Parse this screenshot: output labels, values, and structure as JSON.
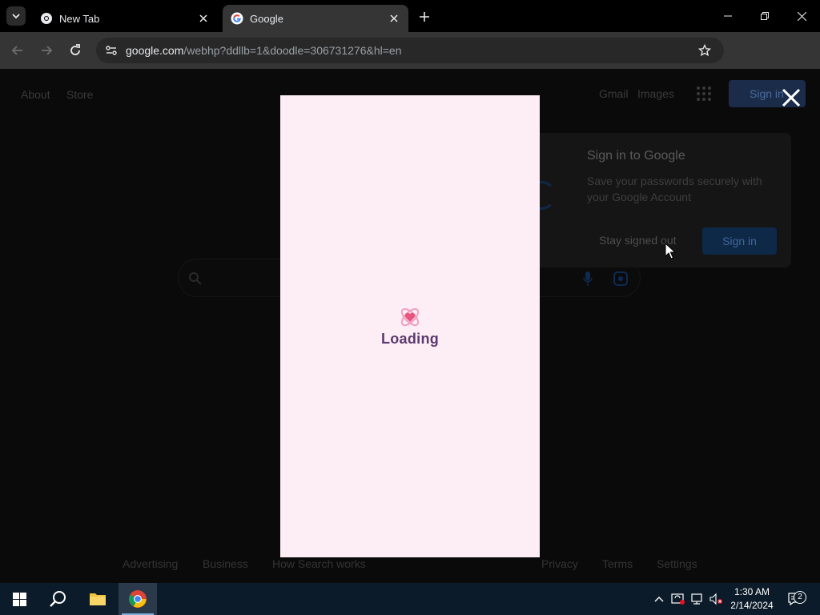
{
  "browser": {
    "tabs": [
      {
        "title": "New Tab",
        "active": false
      },
      {
        "title": "Google",
        "active": true
      }
    ],
    "url": {
      "host": "google.com",
      "path": "/webhp?ddllb=1&doodle=306731276&hl=en"
    }
  },
  "page": {
    "header_left": [
      "About",
      "Store"
    ],
    "header_right": [
      "Gmail",
      "Images"
    ],
    "signin_button": "Sign in",
    "signin_popup": {
      "title": "Sign in to Google",
      "description": "Save your passwords securely with your Google Account",
      "dismiss": "Stay signed out",
      "confirm": "Sign in"
    },
    "footer_left": [
      "Advertising",
      "Business",
      "How Search works"
    ],
    "footer_right": [
      "Privacy",
      "Terms",
      "Settings"
    ]
  },
  "modal": {
    "loading_text": "Loading",
    "background_color": "#fdeef5",
    "text_color": "#5a3a6e",
    "heart_color": "#e8557f"
  },
  "taskbar": {
    "time": "1:30 AM",
    "date": "2/14/2024",
    "notification_count": "2"
  },
  "colors": {
    "chrome_toolbar": "#353535",
    "taskbar": "#0c1b29",
    "google_blue": "#1a73e8"
  }
}
